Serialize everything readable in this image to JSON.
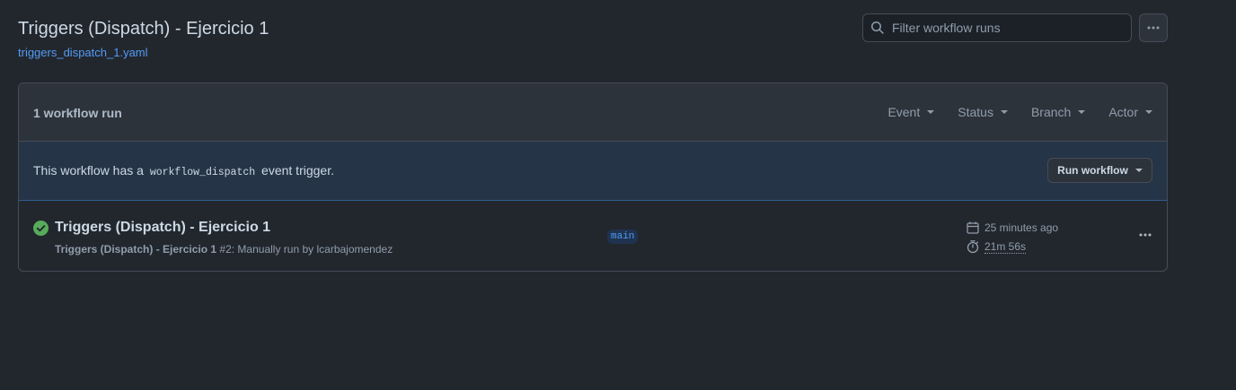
{
  "header": {
    "title": "Triggers (Dispatch) - Ejercicio 1",
    "file_link": "triggers_dispatch_1.yaml"
  },
  "search": {
    "placeholder": "Filter workflow runs",
    "value": ""
  },
  "list": {
    "count_label": "1 workflow run",
    "filters": [
      {
        "label": "Event"
      },
      {
        "label": "Status"
      },
      {
        "label": "Branch"
      },
      {
        "label": "Actor"
      }
    ]
  },
  "banner": {
    "text_before": "This workflow has a ",
    "code": "workflow_dispatch",
    "text_after": " event trigger.",
    "button_label": "Run workflow"
  },
  "runs": [
    {
      "title": "Triggers (Dispatch) - Ejercicio 1",
      "workflow_name": "Triggers (Dispatch) - Ejercicio 1",
      "run_number": "#2",
      "description": ": Manually run by lcarbajomendez",
      "branch": "main",
      "time_ago": "25 minutes ago",
      "duration": "21m 56s",
      "status": "success"
    }
  ],
  "icons": {
    "search": "search-icon",
    "kebab": "kebab-horizontal-icon",
    "status": "check-circle-fill-icon",
    "calendar": "calendar-icon",
    "stopwatch": "stopwatch-icon",
    "caret": "triangle-down-icon"
  },
  "colors": {
    "background": "#22272e",
    "accent_link": "#539bf5",
    "success": "#57ab5a",
    "banner_bg": "#263447"
  }
}
